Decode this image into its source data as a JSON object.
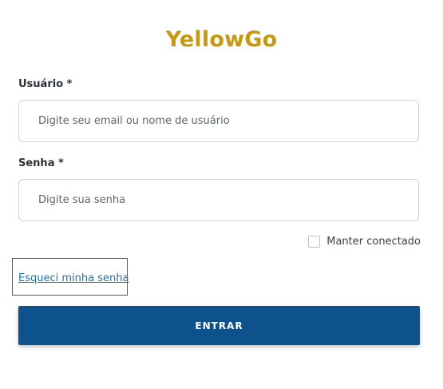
{
  "brand": {
    "name": "YellowGo",
    "color": "#c9980f"
  },
  "form": {
    "user": {
      "label": "Usuário *",
      "value": "",
      "placeholder": "Digite seu email ou nome de usuário"
    },
    "password": {
      "label": "Senha *",
      "value": "",
      "placeholder": "Digite sua senha"
    },
    "remember": {
      "label": "Manter conectado",
      "checked": false
    },
    "forgot_link": "Esqueci minha senha",
    "submit_label": "ENTRAR"
  },
  "colors": {
    "primary_button": "#0d528c",
    "link": "#1a6fb8",
    "highlight_border": "#e0201f"
  }
}
